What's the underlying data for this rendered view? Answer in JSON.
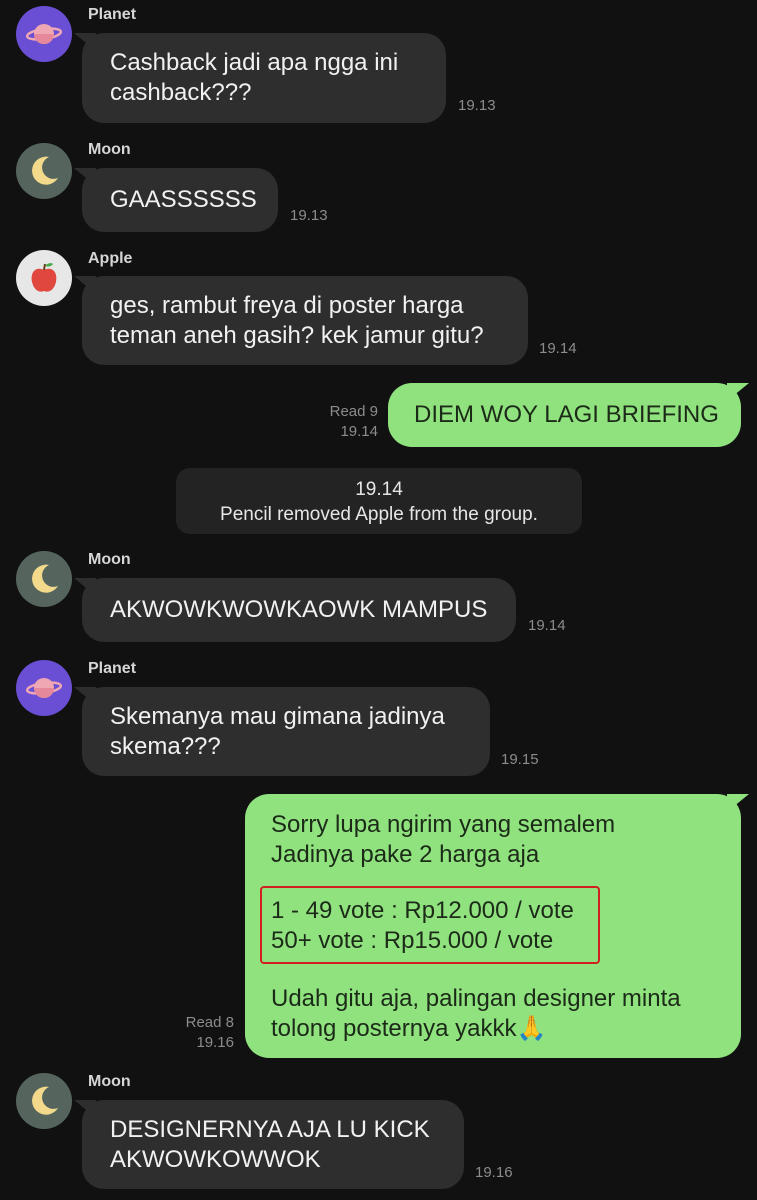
{
  "colors": {
    "background": "#111111",
    "incoming_bubble": "#2e2e2e",
    "outgoing_bubble": "#8fe27e",
    "highlight": "#d02020"
  },
  "messages": {
    "m1": {
      "sender": "Planet",
      "avatar": "planet-icon",
      "lines": [
        "Cashback jadi apa ngga ini",
        "cashback???"
      ],
      "time": "19.13"
    },
    "m2": {
      "sender": "Moon",
      "avatar": "moon-icon",
      "lines": [
        "GAASSSSSS"
      ],
      "time": "19.13"
    },
    "m3": {
      "sender": "Apple",
      "avatar": "apple-icon",
      "lines": [
        "ges, rambut freya di poster harga",
        "teman aneh gasih? kek jamur gitu?"
      ],
      "time": "19.14"
    },
    "m4": {
      "lines": [
        "DIEM WOY LAGI BRIEFING"
      ],
      "read": "Read 9",
      "time": "19.14"
    },
    "system": {
      "time": "19.14",
      "text": "Pencil removed Apple from the group."
    },
    "m5": {
      "sender": "Moon",
      "avatar": "moon-icon",
      "lines": [
        "AKWOWKWOWKAOWK MAMPUS"
      ],
      "time": "19.14"
    },
    "m6": {
      "sender": "Planet",
      "avatar": "planet-icon",
      "lines": [
        "Skemanya mau gimana jadinya",
        "skema???"
      ],
      "time": "19.15"
    },
    "m7": {
      "lines": [
        "Sorry lupa ngirim yang semalem",
        "Jadinya pake 2 harga aja",
        "1 - 49 vote : Rp12.000 / vote",
        "50+ vote : Rp15.000 / vote",
        "Udah gitu aja, palingan designer minta",
        "tolong posternya yakkk🙏"
      ],
      "read": "Read 8",
      "time": "19.16"
    },
    "m8": {
      "sender": "Moon",
      "avatar": "moon-icon",
      "lines": [
        "DESIGNERNYA AJA LU KICK",
        "AKWOWKOWWOK"
      ],
      "time": "19.16"
    }
  }
}
